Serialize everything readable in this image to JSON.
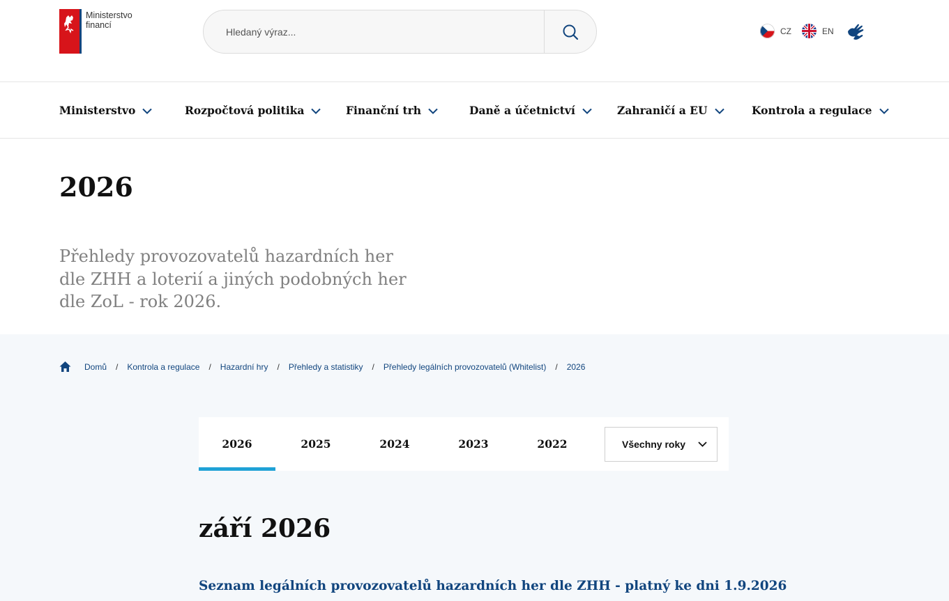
{
  "header": {
    "logo_line1": "Ministerstvo",
    "logo_line2": "financí",
    "search_placeholder": "Hledaný výraz...",
    "languages": [
      {
        "code": "CZ"
      },
      {
        "code": "EN"
      }
    ]
  },
  "nav": {
    "items": [
      {
        "label": "Ministerstvo"
      },
      {
        "label": "Rozpočtová politika"
      },
      {
        "label": "Finanční trh"
      },
      {
        "label": "Daně a účetnictví"
      },
      {
        "label": "Zahraničí a EU"
      },
      {
        "label": "Kontrola a regulace"
      }
    ]
  },
  "page": {
    "title": "2026",
    "lead": "Přehledy provozovatelů hazardních her dle ZHH a loterií a jiných podobných her dle ZoL - rok 2026."
  },
  "breadcrumb": [
    {
      "label": "Domů"
    },
    {
      "label": "Kontrola a regulace"
    },
    {
      "label": "Hazardní hry"
    },
    {
      "label": "Přehledy a statistiky"
    },
    {
      "label": "Přehledy legálních provozovatelů (Whitelist)"
    },
    {
      "label": "2026"
    }
  ],
  "tabs": {
    "years": [
      {
        "label": "2026",
        "active": true
      },
      {
        "label": "2025"
      },
      {
        "label": "2024"
      },
      {
        "label": "2023"
      },
      {
        "label": "2022"
      }
    ],
    "all_years_label": "Všechny roky"
  },
  "content": {
    "month_heading": "září 2026",
    "document_link": "Seznam legálních provozovatelů hazardních her dle ZHH - platný ke dni 1.9.2026"
  },
  "colors": {
    "brand_blue": "#11457e",
    "tab_accent": "#1fa2d6",
    "flag_red": "#d7141a"
  }
}
